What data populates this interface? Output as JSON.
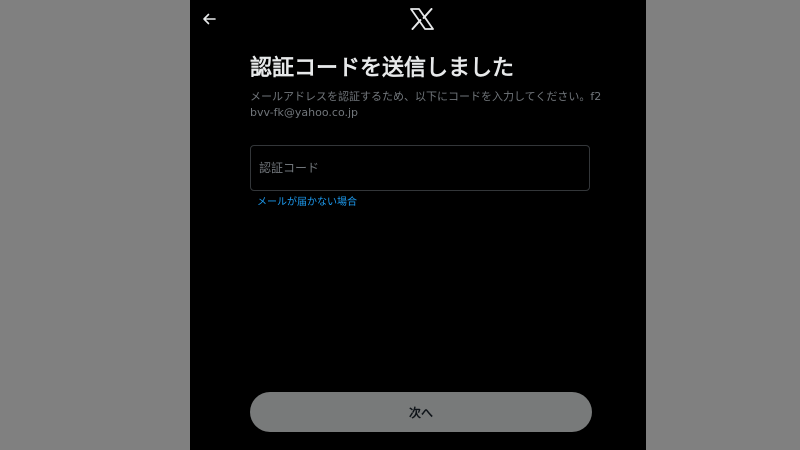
{
  "header": {
    "back_icon": "arrow-left-icon",
    "logo_icon": "x-logo-icon"
  },
  "title": "認証コードを送信しました",
  "subtitle": "メールアドレスを認証するため、以下にコードを入力してください。f2bvv-fk@yahoo.co.jp",
  "code_input": {
    "placeholder": "認証コード",
    "value": ""
  },
  "help_link": "メールが届かない場合",
  "next_button": "次へ",
  "colors": {
    "backdrop": "#808080",
    "modal_background": "#000000",
    "title_text": "#e7e9ea",
    "secondary_text": "#71767b",
    "link": "#1d9bf0",
    "button_background": "#787a7a"
  }
}
